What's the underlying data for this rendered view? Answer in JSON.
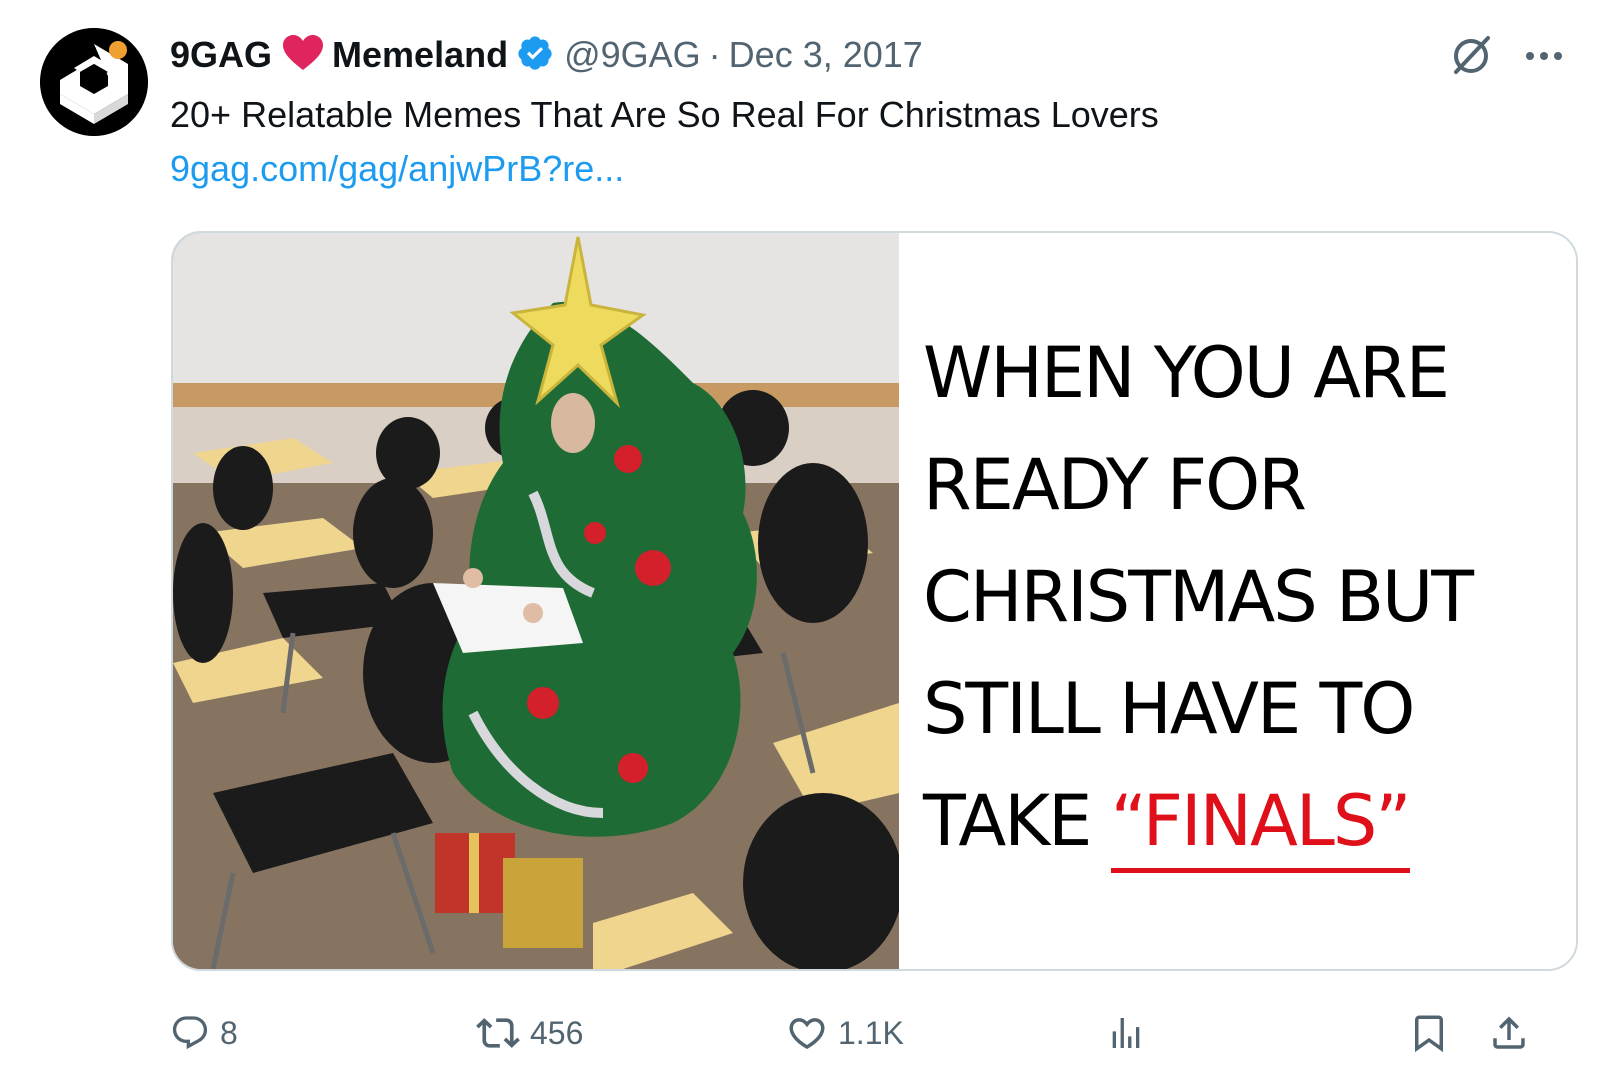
{
  "tweet": {
    "display_name": "9GAG",
    "display_name_2": "Memeland",
    "handle": "@9GAG",
    "separator": "·",
    "date": "Dec 3, 2017",
    "text": "20+ Relatable Memes That Are So Real For Christmas Lovers",
    "link": "9gag.com/gag/anjwPrB?re..."
  },
  "media": {
    "caption_line_1": "WHEN YOU ARE",
    "caption_line_2": "READY FOR",
    "caption_line_3": "CHRISTMAS BUT",
    "caption_line_4": "STILL HAVE TO",
    "caption_line_5_prefix": "TAKE",
    "caption_line_5_highlight": "“FINALS”",
    "highlight_color": "#e0101a"
  },
  "actions": {
    "replies": "8",
    "retweets": "456",
    "likes": "1.1K"
  },
  "icons": {
    "avatar": "9gag-logo-icon",
    "heart": "heart-icon",
    "verified": "verified-badge-icon",
    "grok": "grok-icon",
    "more": "more-icon",
    "reply": "reply-icon",
    "retweet": "retweet-icon",
    "like": "like-icon",
    "views": "views-icon",
    "bookmark": "bookmark-icon",
    "share": "share-icon"
  },
  "colors": {
    "link": "#1d9bf0",
    "heart": "#e0245e",
    "verified": "#1d9bf0",
    "muted": "#536471"
  }
}
